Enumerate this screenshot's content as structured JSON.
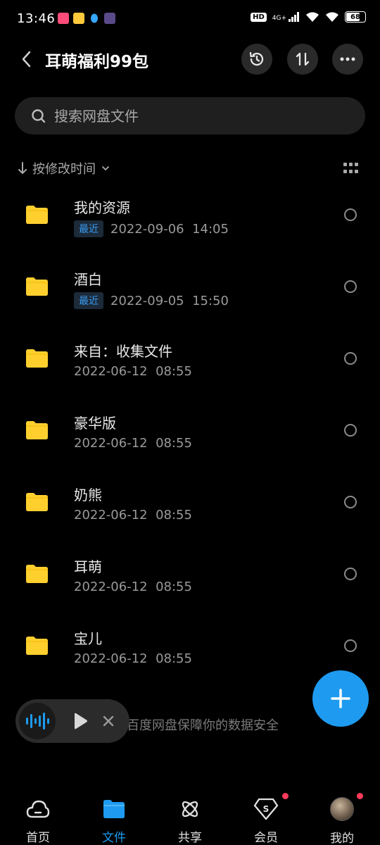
{
  "status": {
    "time": "13:46",
    "network": "4G+",
    "hd": "HD",
    "battery": "68",
    "battery_level": 0.68
  },
  "header": {
    "title": "耳萌福利99包",
    "icons": [
      "back-icon",
      "history-icon",
      "sort-icon",
      "more-icon"
    ]
  },
  "search": {
    "placeholder": "搜索网盘文件"
  },
  "sort": {
    "label": "按修改时间"
  },
  "files": [
    {
      "name": "我的资源",
      "badge": "最近",
      "date": "2022-09-06",
      "time": "14:05"
    },
    {
      "name": "酒白",
      "badge": "最近",
      "date": "2022-09-05",
      "time": "15:50"
    },
    {
      "name": "来自：收集文件",
      "badge": "",
      "date": "2022-06-12",
      "time": "08:55"
    },
    {
      "name": "豪华版",
      "badge": "",
      "date": "2022-06-12",
      "time": "08:55"
    },
    {
      "name": "奶熊",
      "badge": "",
      "date": "2022-06-12",
      "time": "08:55"
    },
    {
      "name": "耳萌",
      "badge": "",
      "date": "2022-06-12",
      "time": "08:55"
    },
    {
      "name": "宝儿",
      "badge": "",
      "date": "2022-06-12",
      "time": "08:55"
    }
  ],
  "footer": {
    "text": "百度网盘保障你的数据安全"
  },
  "nav": {
    "items": [
      {
        "label": "首页",
        "icon": "cloud-icon"
      },
      {
        "label": "文件",
        "icon": "folder-icon",
        "active": true
      },
      {
        "label": "共享",
        "icon": "atom-icon"
      },
      {
        "label": "会员",
        "icon": "vip-diamond-icon",
        "dot": true
      },
      {
        "label": "我的",
        "icon": "avatar",
        "dot": true
      }
    ]
  },
  "colors": {
    "accent": "#1e9bf0",
    "folder": "#ffcf2e",
    "background": "#000000",
    "badge_dot": "#ff3b5c"
  }
}
